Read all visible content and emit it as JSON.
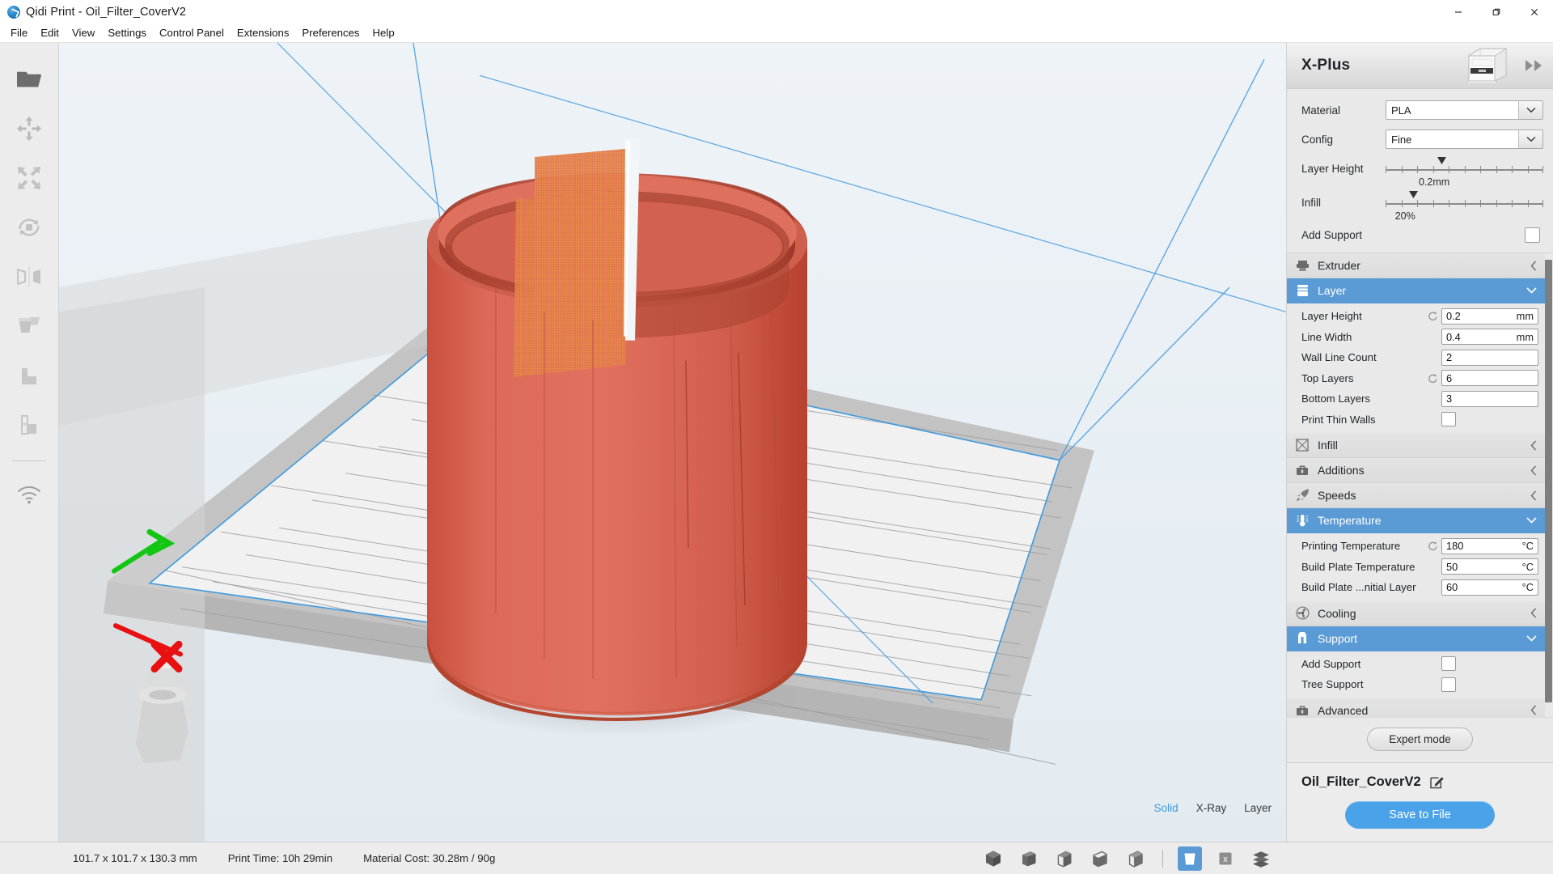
{
  "window": {
    "title": "Qidi Print - Oil_Filter_CoverV2",
    "app_icon": "qidi-logo-icon",
    "minimize": "minimize-icon",
    "maximize": "restore-icon",
    "close": "close-icon"
  },
  "menubar": {
    "items": [
      {
        "label": "File"
      },
      {
        "label": "Edit"
      },
      {
        "label": "View"
      },
      {
        "label": "Settings"
      },
      {
        "label": "Control Panel"
      },
      {
        "label": "Extensions"
      },
      {
        "label": "Preferences"
      },
      {
        "label": "Help"
      }
    ]
  },
  "toolrail": {
    "items": [
      {
        "name": "open-file-icon"
      },
      {
        "name": "move-icon"
      },
      {
        "name": "scale-icon"
      },
      {
        "name": "rotate-icon"
      },
      {
        "name": "mirror-icon"
      },
      {
        "name": "per-model-settings-icon"
      },
      {
        "name": "support-blocker-icon"
      },
      {
        "name": "cut-tool-icon"
      }
    ],
    "network": {
      "name": "wifi-icon"
    }
  },
  "viewport": {
    "view_modes": [
      {
        "label": "Solid",
        "active": true
      },
      {
        "label": "X-Ray",
        "active": false
      },
      {
        "label": "Layer",
        "active": false
      }
    ],
    "model_color": "#d9604f",
    "overhang_color": "#e8873c",
    "plate_color": "#c9c9c9",
    "boundary_color": "#3e9ade",
    "axis_x_color": "#e81010",
    "axis_y_color": "#13c613",
    "background_color": "#e7eef3"
  },
  "right_panel": {
    "printer_name": "X-Plus",
    "printer_image": "printer-illustration",
    "collapse": "double-chevron-right-icon",
    "quick_settings": {
      "material": {
        "label": "Material",
        "value": "PLA"
      },
      "config": {
        "label": "Config",
        "value": "Fine"
      },
      "layer_height": {
        "label": "Layer Height",
        "value": "0.2mm",
        "marker_pct": 36,
        "ticks": 11
      },
      "infill": {
        "label": "Infill",
        "value": "20%",
        "marker_pct": 18,
        "ticks": 11
      },
      "add_support": {
        "label": "Add Support",
        "checked": false
      }
    },
    "sections": [
      {
        "title": "Extruder",
        "icon": "extruder-icon",
        "open": false,
        "chevron": "chevron-left-icon",
        "rows": []
      },
      {
        "title": "Layer",
        "icon": "layer-icon",
        "open": true,
        "chevron": "chevron-down-icon",
        "rows": [
          {
            "label": "Layer Height",
            "value": "0.2",
            "unit": "mm",
            "reset": true,
            "type": "field"
          },
          {
            "label": "Line Width",
            "value": "0.4",
            "unit": "mm",
            "reset": false,
            "type": "field"
          },
          {
            "label": "Wall Line Count",
            "value": "2",
            "unit": "",
            "reset": false,
            "type": "field"
          },
          {
            "label": "Top Layers",
            "value": "6",
            "unit": "",
            "reset": true,
            "type": "field"
          },
          {
            "label": "Bottom Layers",
            "value": "3",
            "unit": "",
            "reset": false,
            "type": "field"
          },
          {
            "label": "Print Thin Walls",
            "value": "",
            "unit": "",
            "reset": false,
            "type": "checkbox",
            "checked": false
          }
        ]
      },
      {
        "title": "Infill",
        "icon": "infill-icon",
        "open": false,
        "chevron": "chevron-left-icon",
        "rows": []
      },
      {
        "title": "Additions",
        "icon": "additions-icon",
        "open": false,
        "chevron": "chevron-left-icon",
        "rows": []
      },
      {
        "title": "Speeds",
        "icon": "speeds-icon",
        "open": false,
        "chevron": "chevron-left-icon",
        "rows": []
      },
      {
        "title": "Temperature",
        "icon": "temperature-icon",
        "open": true,
        "chevron": "chevron-down-icon",
        "rows": [
          {
            "label": "Printing Temperature",
            "value": "180",
            "unit": "°C",
            "reset": true,
            "type": "field"
          },
          {
            "label": "Build Plate Temperature",
            "value": "50",
            "unit": "°C",
            "reset": false,
            "type": "field"
          },
          {
            "label": "Build Plate ...nitial Layer",
            "value": "60",
            "unit": "°C",
            "reset": false,
            "type": "field"
          }
        ]
      },
      {
        "title": "Cooling",
        "icon": "cooling-icon",
        "open": false,
        "chevron": "chevron-left-icon",
        "rows": []
      },
      {
        "title": "Support",
        "icon": "support-icon",
        "open": true,
        "chevron": "chevron-down-icon",
        "rows": [
          {
            "label": "Add Support",
            "value": "",
            "unit": "",
            "reset": false,
            "type": "checkbox",
            "checked": false
          },
          {
            "label": "Tree Support",
            "value": "",
            "unit": "",
            "reset": false,
            "type": "checkbox",
            "checked": false
          }
        ]
      },
      {
        "title": "Advanced",
        "icon": "advanced-icon",
        "open": false,
        "chevron": "chevron-left-icon",
        "rows": []
      }
    ],
    "expert_mode_label": "Expert mode",
    "file_name": "Oil_Filter_CoverV2",
    "edit_icon": "edit-pencil-icon",
    "save_label": "Save to File",
    "save_color": "#4aa3e8"
  },
  "statusbar": {
    "dimensions": "101.7 x 101.7 x 130.3 mm",
    "print_time": "Print Time: 10h 29min",
    "material_cost": "Material Cost: 30.28m / 90g",
    "view_buttons": [
      {
        "name": "view-3d-icon"
      },
      {
        "name": "view-front-icon"
      },
      {
        "name": "view-top-icon"
      },
      {
        "name": "view-left-icon"
      },
      {
        "name": "view-right-icon"
      }
    ],
    "mode_buttons": [
      {
        "name": "solid-view-icon",
        "selected": true
      },
      {
        "name": "xray-view-icon",
        "label": "x",
        "selected": false
      },
      {
        "name": "layer-view-icon",
        "selected": false
      }
    ]
  }
}
